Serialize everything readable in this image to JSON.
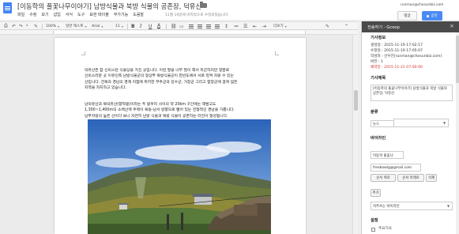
{
  "header": {
    "doc_title": "[이동학의 풀꽃나무이야기] 남방식물과 북방 식물의 공존장, 덕유산",
    "user_email": "runmun@chosunbiz.com",
    "comments_label": "댓글",
    "share_label": "공유"
  },
  "menu": {
    "items": [
      "파일",
      "수정",
      "보기",
      "삽입",
      "서식",
      "도구",
      "표",
      "부가기능",
      "도움말"
    ],
    "visible": [
      "파일",
      "수정",
      "보기",
      "삽입",
      "서식",
      "도구",
      "표현 테이블",
      "부가기능",
      "도움말"
    ],
    "save_status": "11월 19일에 마지막으로 수정되었습니다."
  },
  "toolbar": {
    "zoom": "100%",
    "style": "일반 텍스트",
    "font": "Arial",
    "size": "11",
    "more": "더보기",
    "bold": "B",
    "italic": "I",
    "underline": "U",
    "text_color": "A"
  },
  "document": {
    "para1": [
      "덕유산은 참 신비스런 식물상을 가진 곳입니다. 이런 말을 너무 많이 해서 피곤하지만 정말로",
      "신비스러운 곳 이유인즉 남방식물군의 정상부 북방식물군이 한반도에서 서로 엉켜 자랄 수 있는",
      "산입니다. 전북과 경남의 경계 지점에 위치한 무주군과 장수군, 거창군 그리고 함양군에 걸쳐 넓은",
      "지역을 차지하고 있습니다."
    ],
    "para2": [
      "남덕유산과 북덕유산(향적봉)이라는 두 봉우리 사이의 약 20km 구간에는 해발고도",
      "1,300~1,400m의 소백산맥 주맥이 북동-남서 방향으로 뻗어 있는 전형적인 경남을 가릅니다.",
      "남부지방의 높은 산이다 보니 자연히 남방 식물과 북방 식물이 공존하는 터전이 형성됩니다."
    ]
  },
  "panel": {
    "title": "전송하기 - Gcoop",
    "section_info": "기사정보",
    "created": "생성일 : 2015-11-19 17:02:17",
    "modified": "수정일 : 2015-11-19 17:05:07",
    "author": "작성자 : 선우진(runman@chosunbiz.com)",
    "version": "버전 : 1",
    "reserved": "예약일 : 2015-11-21 07:00:00",
    "section_title": "기사제목",
    "article_title": "[이동학의 풀꽃나무이야기] 남방식물과 북방 식물의 공존장, 덕유산",
    "section_category": "분류",
    "category_value": "뉴스",
    "section_byline": "바이라인",
    "byline_name": "이동학 풀꽃나",
    "byline_email": "freebowlg@gmail.com",
    "order_up": "순서 위로",
    "order_down": "순서 아래로",
    "delete": "삭제",
    "add": "추가",
    "frequent_byline": "자주쓰는 바이라인",
    "section_settings": "설정",
    "top_article": "주요기사"
  },
  "colors": {
    "accent": "#4a8af4",
    "panel_header": "#4a4a4a",
    "warning_text": "#d0312d"
  }
}
